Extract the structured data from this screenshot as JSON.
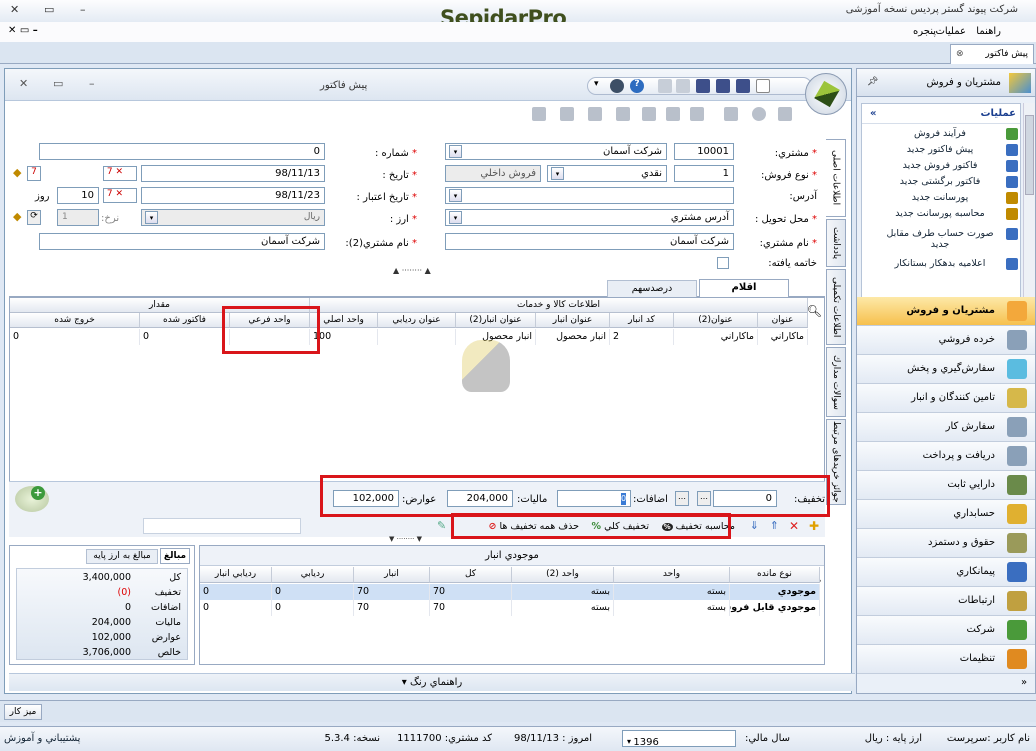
{
  "app": {
    "title": "شرکت پیوند گستر پردیس نسخه آموزشی",
    "brand": "SepidarPro",
    "brand_accent": "Pro"
  },
  "menu": {
    "operations": "عمليات",
    "help": "راهنما",
    "window": "پنجره"
  },
  "doc_tab": "پیش فاکتور",
  "window": {
    "title": "پیش فاکتور"
  },
  "form": {
    "customer_label": "مشتري:",
    "customer_code": "10001",
    "customer_name": "شرکت آسمان",
    "sale_type_label": "نوع فروش:",
    "sale_type_code": "1",
    "sale_type_name": "نقدي",
    "sale_type_kind": "فروش داخلي",
    "address_label": "آدرس:",
    "delivery_label": "محل تحويل :",
    "delivery_value": "آدرس مشتري",
    "customer_name_label": "نام مشتري:",
    "customer_name_value": "شرکت آسمان",
    "closing_label": "خاتمه يافته:",
    "number_label": "شماره :",
    "number_value": "0",
    "date_label": "تاریخ :",
    "date_value": "98/11/13",
    "valid_label": "تاریخ اعتبار :",
    "valid_value": "98/11/23",
    "days_value": "10",
    "days_label": "روز",
    "currency_label": "ارز :",
    "currency_value": "ريال",
    "rate_label": "نرخ:",
    "rate_value": "1",
    "customer2_label": "نام مشتري(2):",
    "customer2_value": "شرکت آسمان"
  },
  "vtabs": [
    "اطلاعات اصلی",
    "يادداشت",
    "اطلاعات تکميلی",
    "سوالات مدارك",
    "جوائز خریدهای مرتبط"
  ],
  "grid_tabs": {
    "items": "اقلام",
    "percent": "درصدسهم"
  },
  "grid": {
    "group1": "اطلاعات کالا و خدمات",
    "group2": "مقدار",
    "headers": [
      "عنوان",
      "عنوان(2)",
      "کد انبار",
      "عنوان انبار",
      "عنوان انبار(2)",
      "عنوان رديابي",
      "واحد اصلي",
      "واحد فرعي",
      "فاكتور شده",
      "خروج شده"
    ],
    "row": [
      "ماکاراني",
      "ماکاراني",
      "2",
      "انبار محصول",
      "انبار محصول",
      "",
      "100",
      "",
      "0",
      "0"
    ]
  },
  "summary": {
    "discount_label": "تخفيف:",
    "discount_value": "0",
    "additions_label": "اضافات:",
    "additions_value": "0",
    "tax_label": "ماليات:",
    "tax_value": "204,000",
    "duties_label": "عوارض:",
    "duties_value": "102,000"
  },
  "actions": {
    "calc_discount": "محاسبه تخفيف",
    "total_discount": "تخفيف کلي",
    "remove_discounts": "حذف همه تخفيف ها"
  },
  "totals_tabs": {
    "amounts": "مبالغ",
    "base_currency": "مبالغ به ارز پايه"
  },
  "totals": [
    {
      "label": "کل",
      "value": "3,400,000"
    },
    {
      "label": "تخفيف",
      "value": "(0)"
    },
    {
      "label": "اضافات",
      "value": "0"
    },
    {
      "label": "ماليات",
      "value": "204,000"
    },
    {
      "label": "عوارض",
      "value": "102,000"
    },
    {
      "label": "خالص",
      "value": "3,706,000"
    }
  ],
  "stock": {
    "title": "موجودي انبار",
    "headers": [
      "نوع مانده",
      "واحد",
      "واحد (2)",
      "کل",
      "انبار",
      "رديابي",
      "رديابي انبار"
    ],
    "rows": [
      [
        "موجودي",
        "بسته",
        "بسته",
        "70",
        "70",
        "0",
        "0"
      ],
      [
        "موجودي قابل فروش",
        "بسته",
        "بسته",
        "70",
        "70",
        "0",
        "0"
      ]
    ]
  },
  "guide": "راهنماي رنگ",
  "sidebar": {
    "section_title": "مشتريان و فروش",
    "ops_title": "عمليات",
    "ops": [
      "فرآيند فروش",
      "پیش فاکتور جدید",
      "فاکتور فروش جدید",
      "فاکتور برگشتی جدید",
      "پورسانت جديد",
      "محاسبه پورسانت جديد",
      "صورت حساب طرف مقابل جديد",
      "اعلاميه بدهکار بستانکار"
    ],
    "nav": [
      "مشتريان و فروش",
      "خرده فروشي",
      "سفارش‌گيري و پخش",
      "تامين کنندگان و انبار",
      "سفارش كار",
      "دريافت و پرداخت",
      "دارايي ثابت",
      "حسابداري",
      "حقوق و دستمزد",
      "پيمانكاري",
      "ارتباطات",
      "شرکت",
      "تنظيمات"
    ]
  },
  "taskbar": {
    "desk": "ميز كار"
  },
  "status": {
    "user": "نام كاربر :سرپرست",
    "base_currency": "ارز پايه :   ريال",
    "fiscal_year": "سال مالي:",
    "year": "1396",
    "today": "امروز :  98/11/13",
    "customer_code": "كد مشتري:  1111700",
    "version": "نسخه:  5.3.4",
    "support": "پشتيباني و آموزش"
  }
}
